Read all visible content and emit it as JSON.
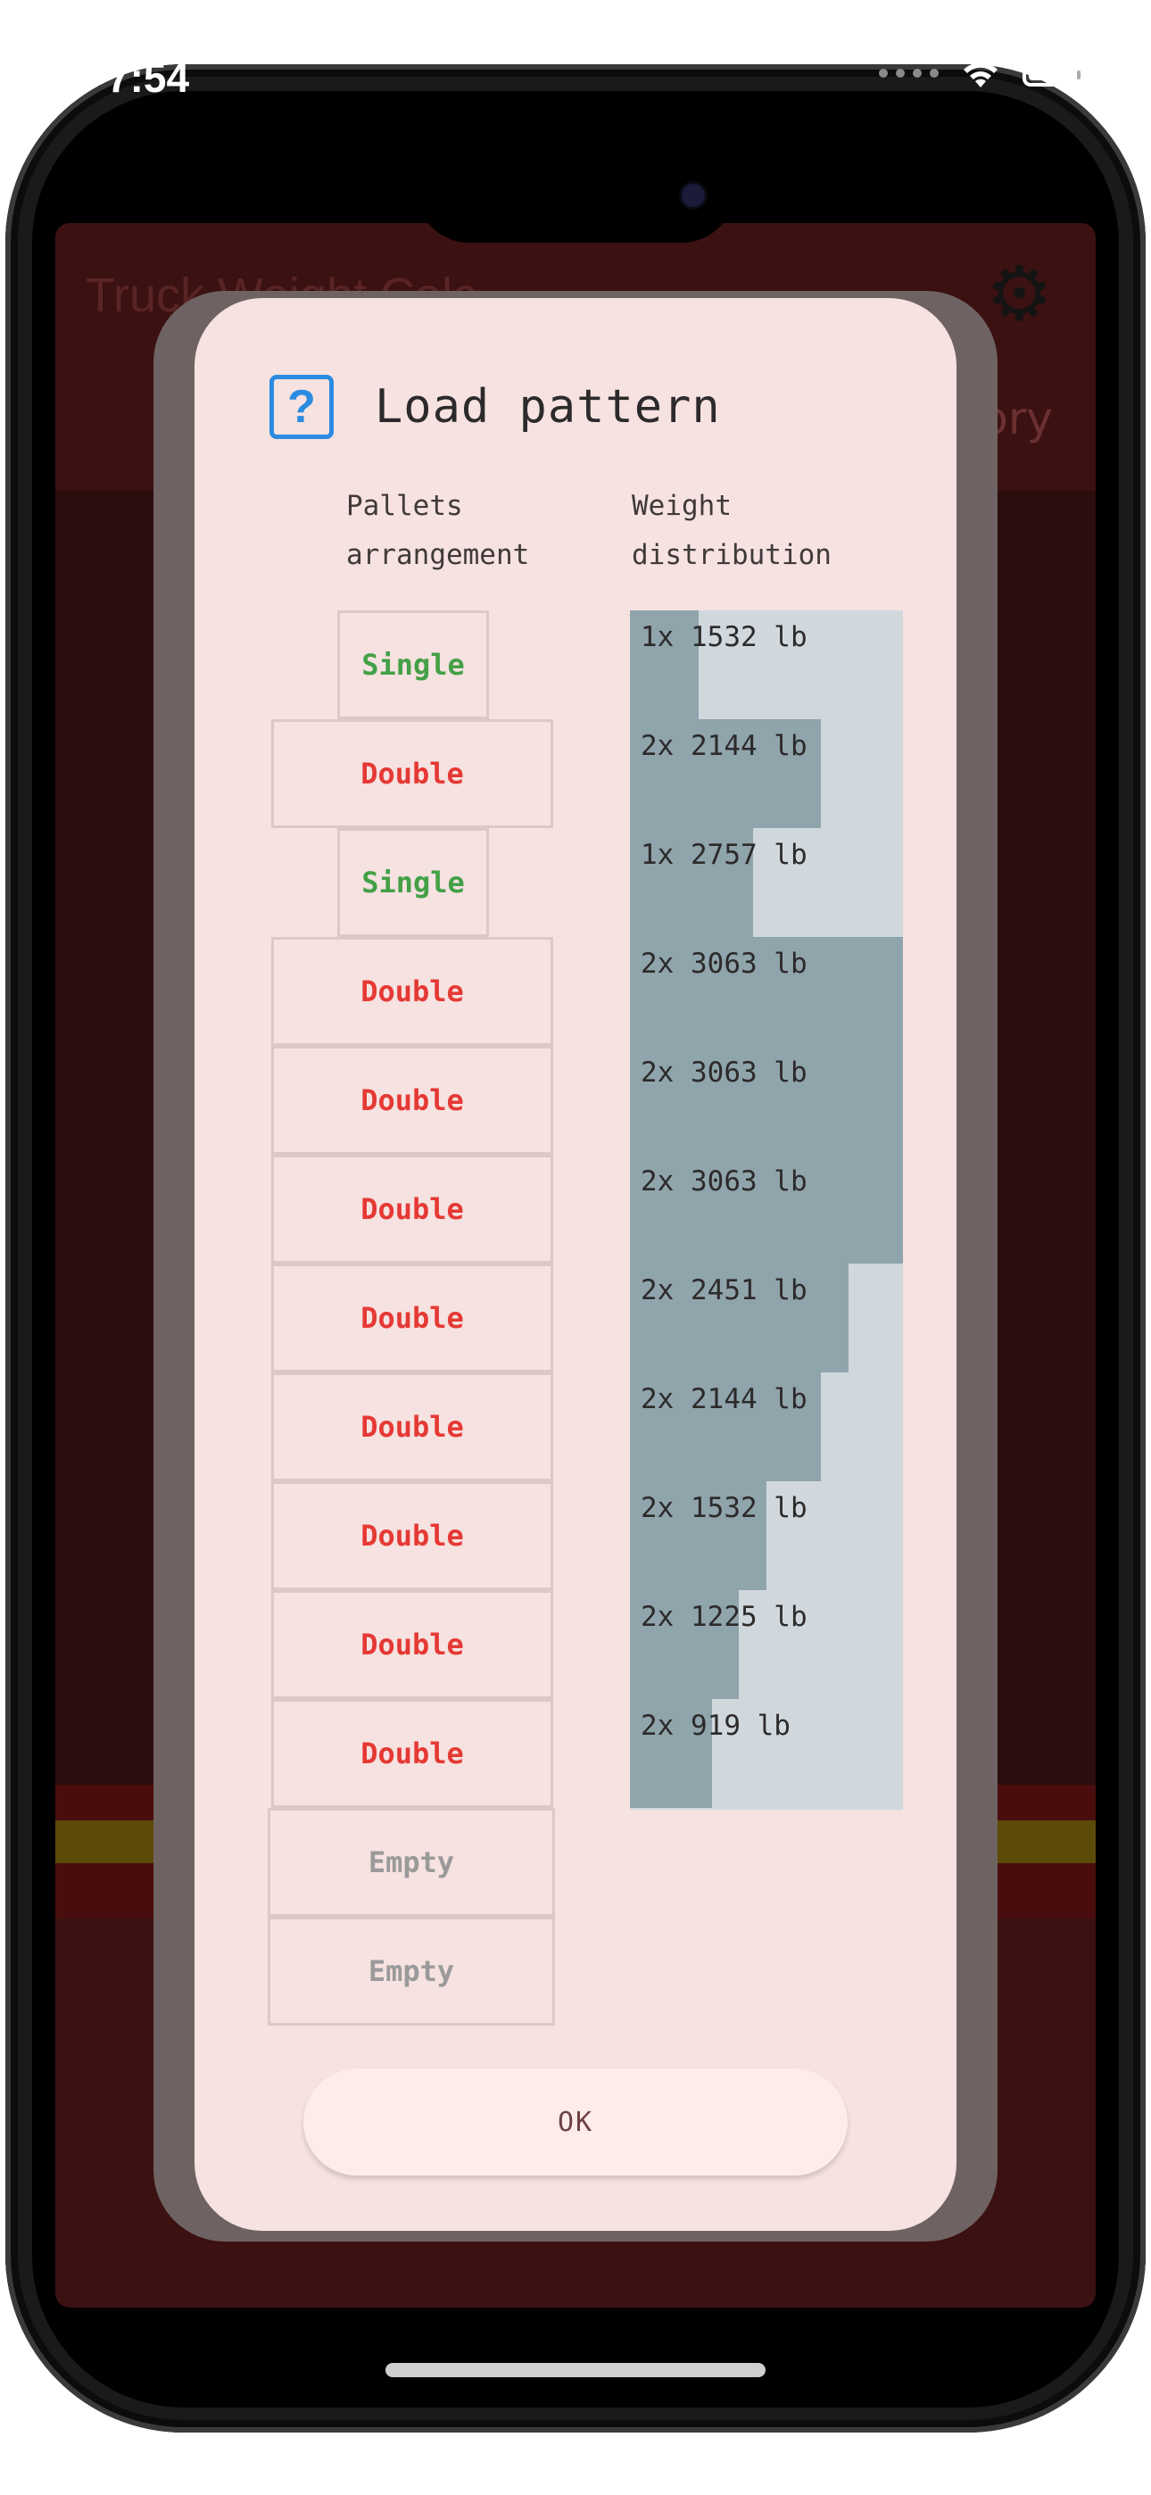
{
  "status_bar": {
    "time": "7:54"
  },
  "background_app": {
    "title": "Truck Weight Calc",
    "tab_right": "ory"
  },
  "dialog": {
    "title": "Load pattern",
    "columns": {
      "pallets": [
        "Pallets",
        "arrangement"
      ],
      "weights": [
        "Weight",
        "distribution"
      ]
    },
    "pallets": [
      {
        "type": "single",
        "label": "Single"
      },
      {
        "type": "double",
        "label": "Double"
      },
      {
        "type": "single",
        "label": "Single"
      },
      {
        "type": "double",
        "label": "Double"
      },
      {
        "type": "double",
        "label": "Double"
      },
      {
        "type": "double",
        "label": "Double"
      },
      {
        "type": "double",
        "label": "Double"
      },
      {
        "type": "double",
        "label": "Double"
      },
      {
        "type": "double",
        "label": "Double"
      },
      {
        "type": "double",
        "label": "Double"
      },
      {
        "type": "double",
        "label": "Double"
      },
      {
        "type": "empty",
        "label": "Empty"
      },
      {
        "type": "empty",
        "label": "Empty"
      }
    ],
    "weight_distribution": [
      {
        "label": "1x 1532 lb",
        "weight": 1532
      },
      {
        "label": "2x 2144 lb",
        "weight": 4288
      },
      {
        "label": "1x 2757 lb",
        "weight": 2757
      },
      {
        "label": "2x 3063 lb",
        "weight": 6126
      },
      {
        "label": "2x 3063 lb",
        "weight": 6126
      },
      {
        "label": "2x 3063 lb",
        "weight": 6126
      },
      {
        "label": "2x 2451 lb",
        "weight": 4902
      },
      {
        "label": "2x 2144 lb",
        "weight": 4288
      },
      {
        "label": "2x 1532 lb",
        "weight": 3064
      },
      {
        "label": "2x 1225 lb",
        "weight": 2450
      },
      {
        "label": "2x 919 lb",
        "weight": 1838
      }
    ],
    "ok_label": "OK"
  },
  "colors": {
    "single": "#43a047",
    "double": "#e53935",
    "empty": "#9a9a9a",
    "bar": "#90a4ac",
    "bar_track": "#d0d8de",
    "icon": "#2b8be0"
  }
}
